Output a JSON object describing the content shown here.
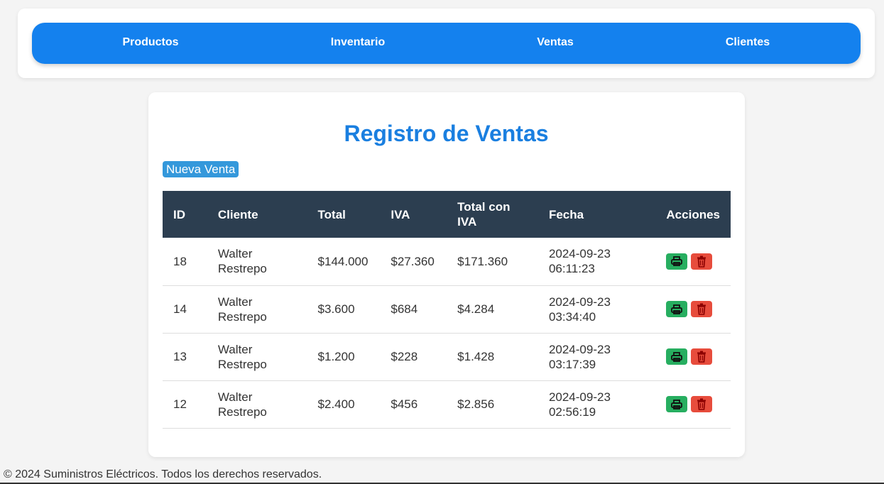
{
  "nav": {
    "items": [
      {
        "label": "Productos"
      },
      {
        "label": "Inventario"
      },
      {
        "label": "Ventas"
      },
      {
        "label": "Clientes"
      }
    ]
  },
  "main": {
    "title": "Registro de Ventas",
    "new_sale_label": "Nueva Venta"
  },
  "table": {
    "headers": {
      "id": "ID",
      "cliente": "Cliente",
      "total": "Total",
      "iva": "IVA",
      "total_iva": "Total con IVA",
      "fecha": "Fecha",
      "acciones": "Acciones"
    },
    "rows": [
      {
        "id": "18",
        "cliente": "Walter Restrepo",
        "total": "$144.000",
        "iva": "$27.360",
        "total_iva": "$171.360",
        "fecha": "2024-09-23 06:11:23"
      },
      {
        "id": "14",
        "cliente": "Walter Restrepo",
        "total": "$3.600",
        "iva": "$684",
        "total_iva": "$4.284",
        "fecha": "2024-09-23 03:34:40"
      },
      {
        "id": "13",
        "cliente": "Walter Restrepo",
        "total": "$1.200",
        "iva": "$228",
        "total_iva": "$1.428",
        "fecha": "2024-09-23 03:17:39"
      },
      {
        "id": "12",
        "cliente": "Walter Restrepo",
        "total": "$2.400",
        "iva": "$456",
        "total_iva": "$2.856",
        "fecha": "2024-09-23 02:56:19"
      }
    ],
    "row_actions": [
      {
        "icon": "print-icon",
        "color": "#27ae60"
      },
      {
        "icon": "trash-icon",
        "color": "#e74c3c"
      }
    ]
  },
  "footer": {
    "text": "© 2024 Suministros Eléctricos. Todos los derechos reservados."
  },
  "colors": {
    "nav_bg": "#1481ee",
    "title": "#1a7fe0",
    "table_header_bg": "#2c3e50",
    "new_sale_btn": "#3498db"
  }
}
